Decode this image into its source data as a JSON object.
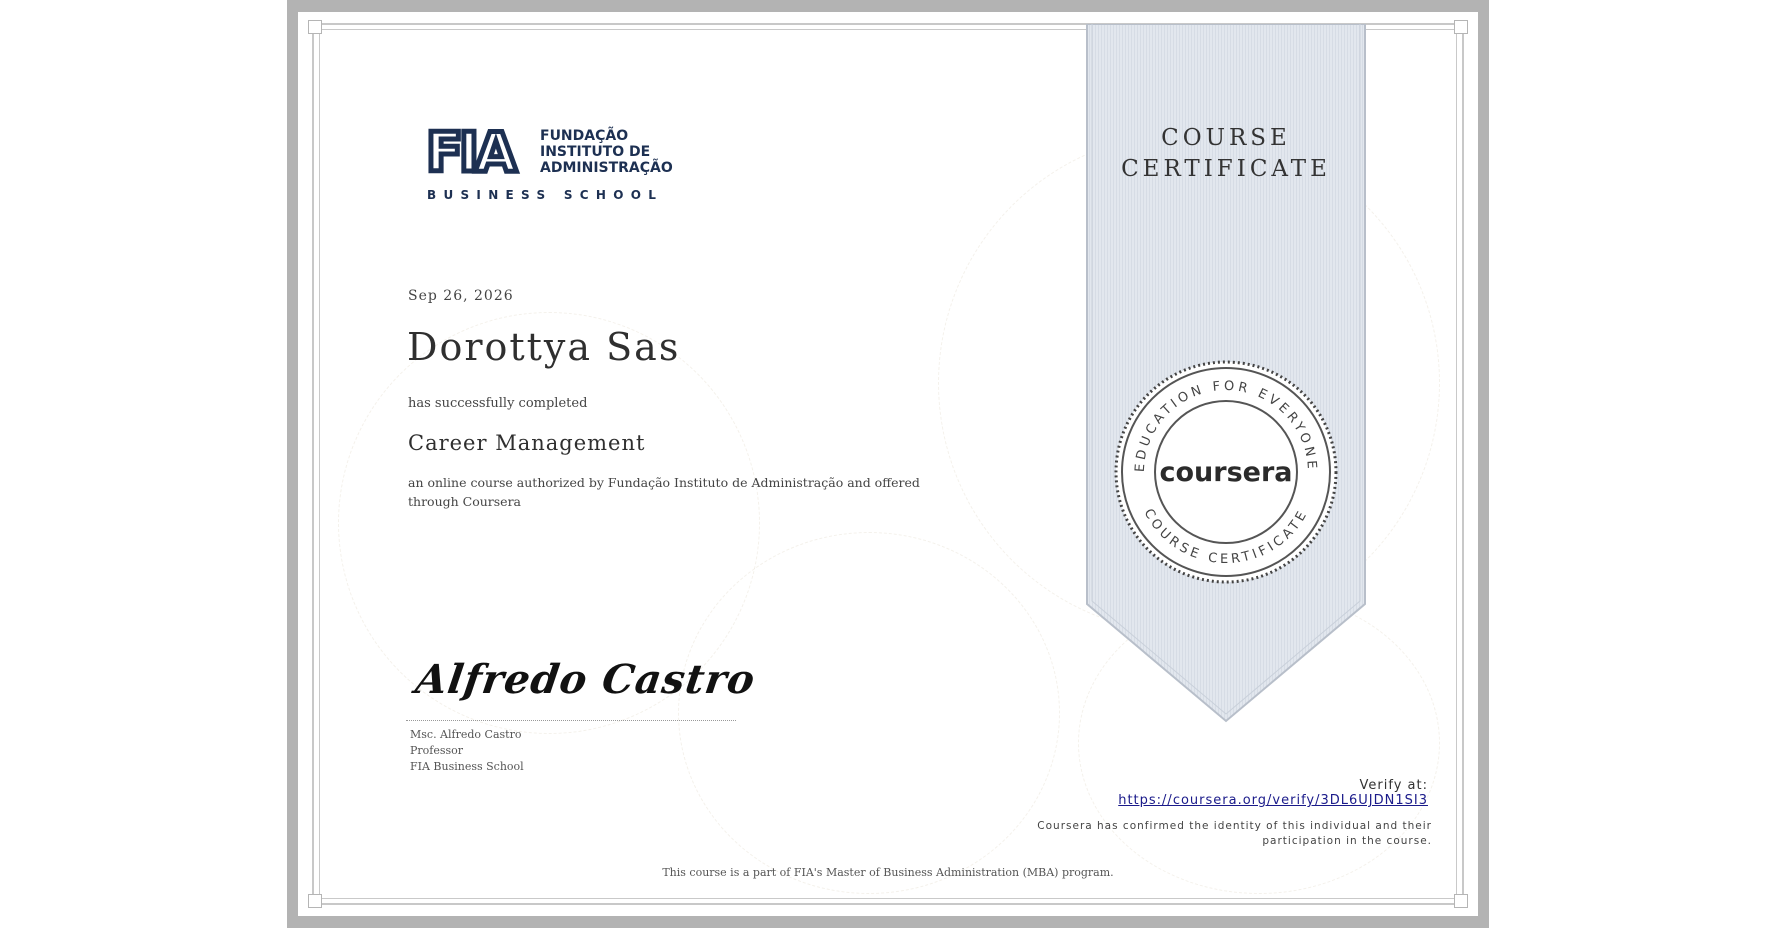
{
  "logo": {
    "letters": "FIA",
    "name_lines": [
      "FUNDAÇÃO",
      "INSTITUTO DE",
      "ADMINISTRAÇÃO"
    ],
    "tagline": "BUSINESS SCHOOL",
    "color": "#1d3052"
  },
  "certificate": {
    "date": "Sep 26, 2026",
    "recipient": "Dorottya Sas",
    "completed_text": "has successfully completed",
    "course_name": "Career Management",
    "description": "an online course authorized by Fundação Instituto de Administração and offered through Coursera"
  },
  "signature": {
    "handwritten": "Alfredo Castro",
    "signer_name": "Msc. Alfredo Castro",
    "signer_title": "Professor",
    "signer_org": "FIA Business School"
  },
  "banner": {
    "title_line1": "COURSE",
    "title_line2": "CERTIFICATE",
    "color": "#e2e7ee"
  },
  "seal": {
    "brand": "coursera",
    "top_text": "EDUCATION FOR EVERYONE",
    "bottom_text": "COURSE CERTIFICATE",
    "icon": "coursera-seal-icon"
  },
  "verify": {
    "label": "Verify at:",
    "url": "https://coursera.org/verify/3DL6UJDN1SI3"
  },
  "confirmation": "Coursera has confirmed the identity of this individual and their participation in the course.",
  "footer": "This course is a part of FIA's Master of Business Administration (MBA) program."
}
